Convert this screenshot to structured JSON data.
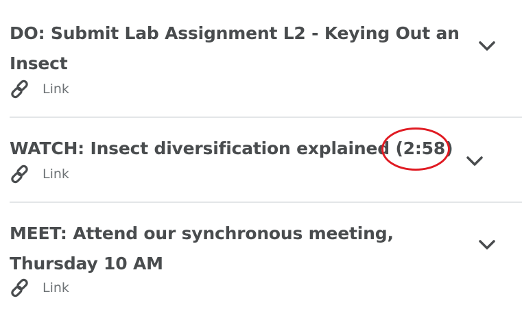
{
  "items": [
    {
      "title_line1": "DO: Submit Lab Assignment L2 - Keying Out an",
      "title_line2": "Insect",
      "link_label": "Link"
    },
    {
      "title_line1": "WATCH: Insect diversification explained (2:58)",
      "link_label": "Link"
    },
    {
      "title_line1": "MEET: Attend our synchronous meeting,",
      "title_line2": "Thursday 10 AM",
      "link_label": "Link"
    }
  ],
  "icons": {
    "link": "link-icon",
    "expand": "chevron-down-icon"
  },
  "colors": {
    "title_text": "#494c4e",
    "link_text": "#6e7376",
    "divider": "#e3e6e8",
    "highlight_circle": "#e01a22"
  }
}
